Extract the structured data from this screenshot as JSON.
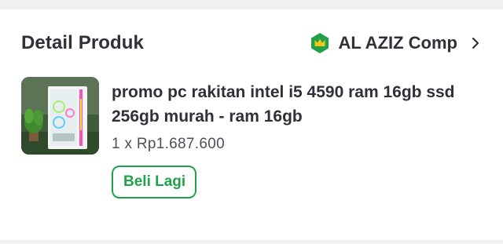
{
  "section": {
    "title": "Detail Produk"
  },
  "shop": {
    "name": "AL AZIZ Comp",
    "badge_icon": "official-store-crown-icon",
    "badge_color": "#21a04a",
    "crown_color": "#f5c518"
  },
  "product": {
    "name": "promo pc rakitan intel i5 4590 ram 16gb ssd 256gb murah - ram 16gb",
    "price_line": "1 x Rp1.687.600",
    "image_icon": "pc-case-thumbnail"
  },
  "actions": {
    "buy_again_label": "Beli Lagi"
  },
  "colors": {
    "accent": "#1fa24a",
    "text": "#2e3137",
    "background": "#f0f1f3"
  }
}
